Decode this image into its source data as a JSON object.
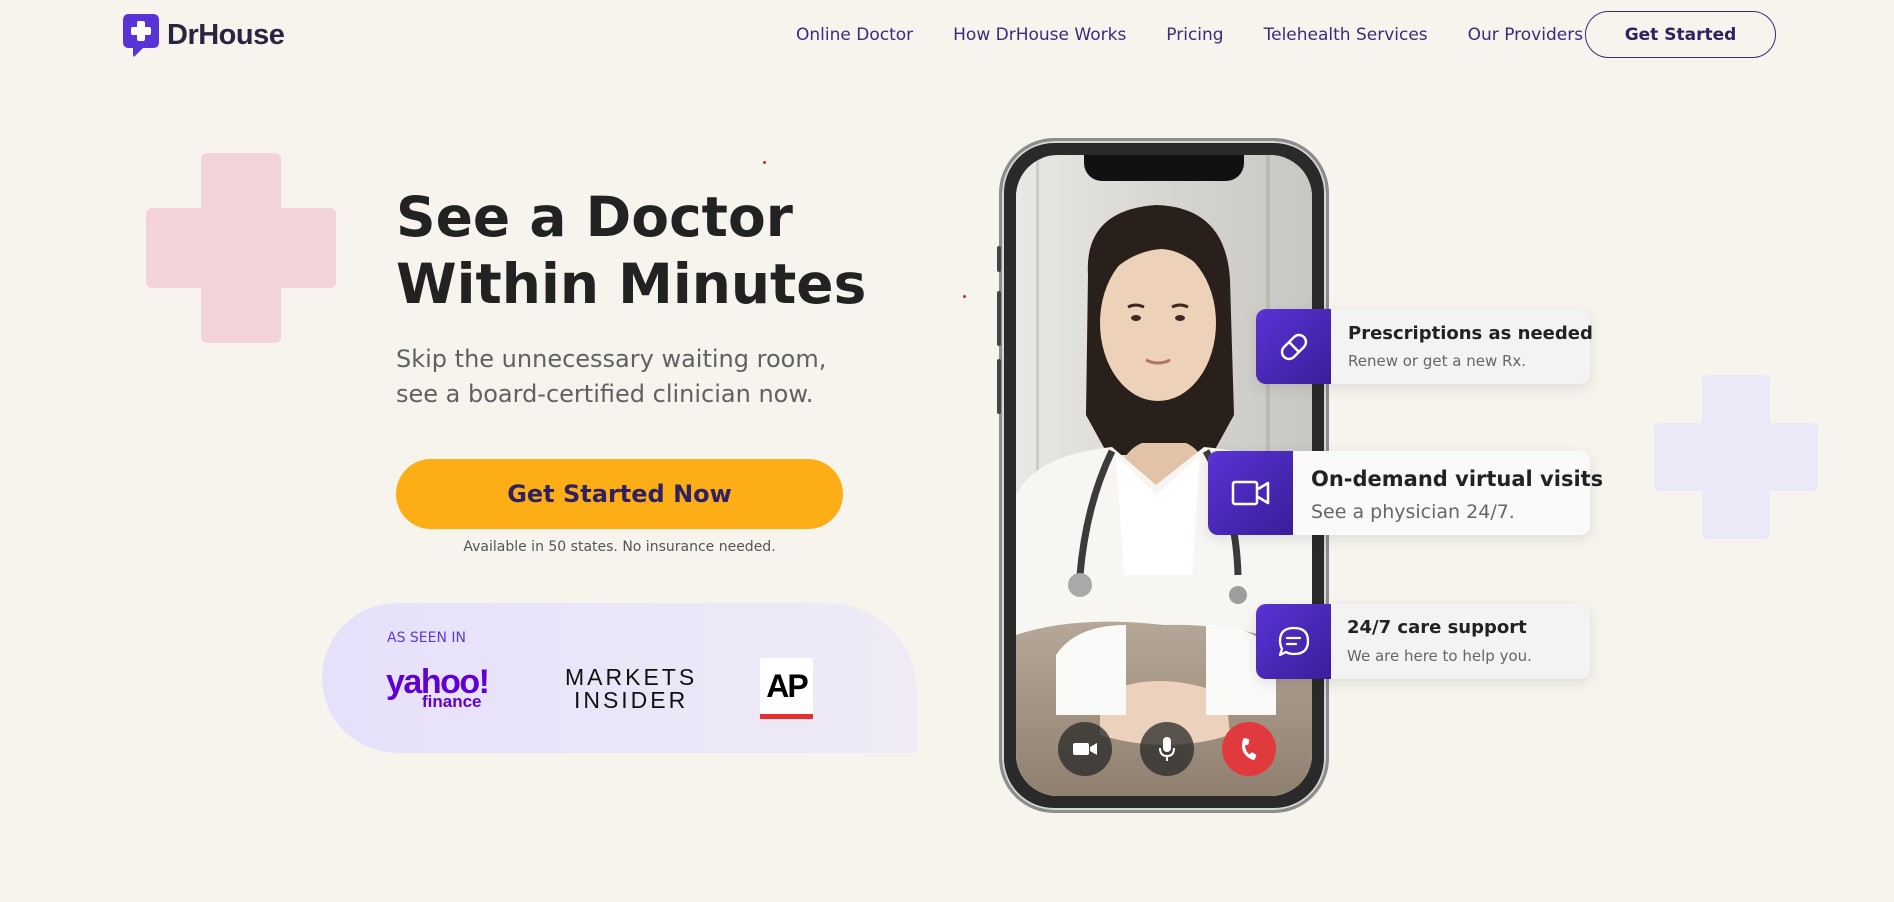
{
  "brand": {
    "name": "DrHouse",
    "logo_icon": "plus-chat-bubble-icon",
    "color_primary": "#5a33d6",
    "color_accent": "#fdae17"
  },
  "nav": {
    "links": [
      {
        "label": "Online Doctor"
      },
      {
        "label": "How DrHouse Works"
      },
      {
        "label": "Pricing"
      },
      {
        "label": "Telehealth Services"
      },
      {
        "label": "Our Providers"
      }
    ],
    "cta_label": "Get Started"
  },
  "hero": {
    "title_line1": "See a Doctor",
    "title_line2": "Within Minutes",
    "subtitle_line1": "Skip the unnecessary waiting room,",
    "subtitle_line2": "see a board-certified clinician now.",
    "cta_label": "Get Started Now",
    "cta_note": "Available in 50 states. No insurance needed."
  },
  "press": {
    "label": "AS SEEN IN",
    "yahoo_main": "yahoo!",
    "yahoo_sub": "finance",
    "markets_line1": "MARKETS",
    "markets_line2": "INSIDER",
    "ap": "AP"
  },
  "phone": {
    "controls": [
      {
        "icon": "video-camera-icon"
      },
      {
        "icon": "microphone-icon"
      },
      {
        "icon": "end-call-icon",
        "color": "#e03a3e"
      }
    ]
  },
  "features": [
    {
      "icon": "pill-icon",
      "title": "Prescriptions as needed",
      "subtitle": "Renew or get a new Rx."
    },
    {
      "icon": "video-icon",
      "title": "On-demand virtual visits",
      "subtitle": "See a physician 24/7."
    },
    {
      "icon": "chat-support-icon",
      "title": "24/7 care support",
      "subtitle": "We are here to help you."
    }
  ]
}
